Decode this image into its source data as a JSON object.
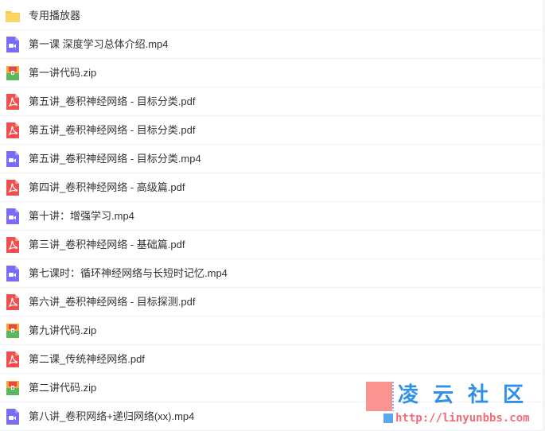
{
  "files": [
    {
      "name": "专用播放器",
      "icon": "folder-icon",
      "type": "folder"
    },
    {
      "name": "第一课 深度学习总体介绍.mp4",
      "icon": "video-file-icon",
      "type": "video"
    },
    {
      "name": "第一讲代码.zip",
      "icon": "zip-file-icon",
      "type": "zip"
    },
    {
      "name": "第五讲_卷积神经网络 - 目标分类.pdf",
      "icon": "pdf-file-icon",
      "type": "pdf"
    },
    {
      "name": "第五讲_卷积神经网络 - 目标分类.pdf",
      "icon": "pdf-file-icon",
      "type": "pdf"
    },
    {
      "name": "第五讲_卷积神经网络 - 目标分类.mp4",
      "icon": "video-file-icon",
      "type": "video"
    },
    {
      "name": "第四讲_卷积神经网络 - 高级篇.pdf",
      "icon": "pdf-file-icon",
      "type": "pdf"
    },
    {
      "name": "第十讲：增强学习.mp4",
      "icon": "video-file-icon",
      "type": "video"
    },
    {
      "name": "第三讲_卷积神经网络 - 基础篇.pdf",
      "icon": "pdf-file-icon",
      "type": "pdf"
    },
    {
      "name": "第七课时：循环神经网络与长短时记忆.mp4",
      "icon": "video-file-icon",
      "type": "video"
    },
    {
      "name": "第六讲_卷积神经网络 - 目标探测.pdf",
      "icon": "pdf-file-icon",
      "type": "pdf"
    },
    {
      "name": "第九讲代码.zip",
      "icon": "zip-file-icon",
      "type": "zip"
    },
    {
      "name": "第二课_传统神经网络.pdf",
      "icon": "pdf-file-icon",
      "type": "pdf"
    },
    {
      "name": "第二讲代码.zip",
      "icon": "zip-file-icon",
      "type": "zip"
    },
    {
      "name": "第八讲_卷积网络+递归网络(xx).mp4",
      "icon": "video-file-icon",
      "type": "video"
    }
  ],
  "watermark": {
    "title": "凌云社区",
    "url": "http://linyunbbs.com"
  },
  "colors": {
    "folder": "#f9c940",
    "video": "#7b6cf6",
    "pdf": "#f0504d",
    "zip_top": "#f4a93b",
    "zip_bottom": "#5cb85c",
    "text": "#333333",
    "row_border": "#eef1f5"
  }
}
